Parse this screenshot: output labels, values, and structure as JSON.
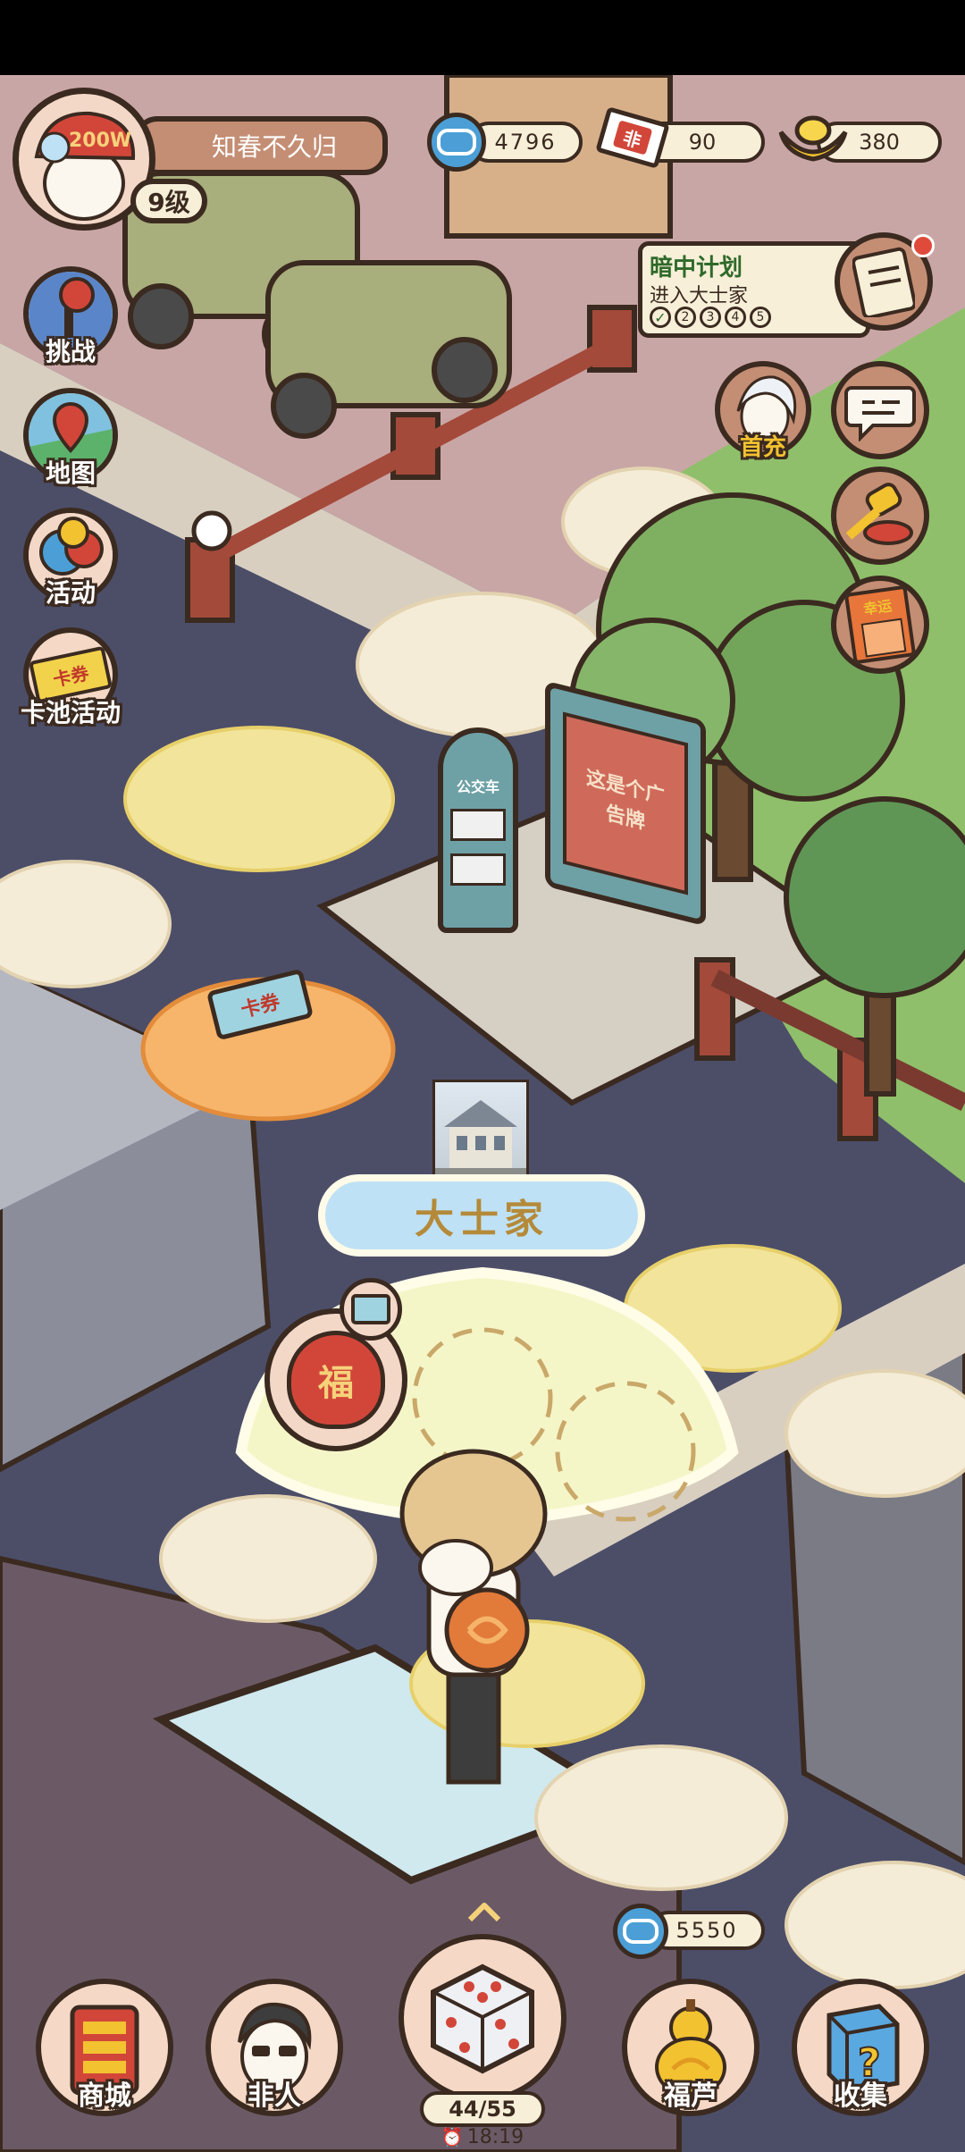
{
  "player": {
    "name": "知春不久归",
    "level": "9级",
    "avatar_badge": "200W"
  },
  "currencies": [
    {
      "icon": "cloud-coin-icon",
      "value": "4796"
    },
    {
      "icon": "ticket-icon",
      "value": "90",
      "badge": "非"
    },
    {
      "icon": "gold-ingot-icon",
      "value": "380"
    }
  ],
  "left_menu": [
    {
      "label": "挑战",
      "icon": "joystick-icon"
    },
    {
      "label": "地图",
      "icon": "map-pin-icon"
    },
    {
      "label": "活动",
      "icon": "balloons-icon"
    },
    {
      "label": "卡池活动",
      "icon": "card-ticket-icon",
      "icon_text": "卡券"
    }
  ],
  "quest": {
    "title": "暗中计划",
    "subtitle": "进入大士家",
    "steps": [
      "2",
      "3",
      "4",
      "5"
    ]
  },
  "right_menu": [
    {
      "label": "首充",
      "icon": "first-charge-character-icon"
    },
    {
      "label": "",
      "icon": "chat-bubble-icon"
    },
    {
      "label": "",
      "icon": "gavel-icon"
    },
    {
      "label": "幸运",
      "icon": "lucky-ticket-icon"
    }
  ],
  "map": {
    "bus_stop_sign": "公交车",
    "billboard_text": "这是个广告牌",
    "ticket_tile_text": "卡券",
    "fortune_bag_text": "福",
    "location_name": "大士家"
  },
  "bottom": {
    "cloud_cost": "5550",
    "dice_count": "44/55",
    "timer": "18:19",
    "nav": [
      {
        "label": "商城",
        "icon": "shop-icon"
      },
      {
        "label": "非人",
        "icon": "character-icon"
      },
      {
        "label": "福芦",
        "icon": "gourd-icon"
      },
      {
        "label": "收集",
        "icon": "mystery-box-icon"
      }
    ]
  },
  "colors": {
    "outline": "#3b2a20",
    "panel": "#f7efd8",
    "accent_red": "#d2463a",
    "road": "#4b4d66"
  }
}
